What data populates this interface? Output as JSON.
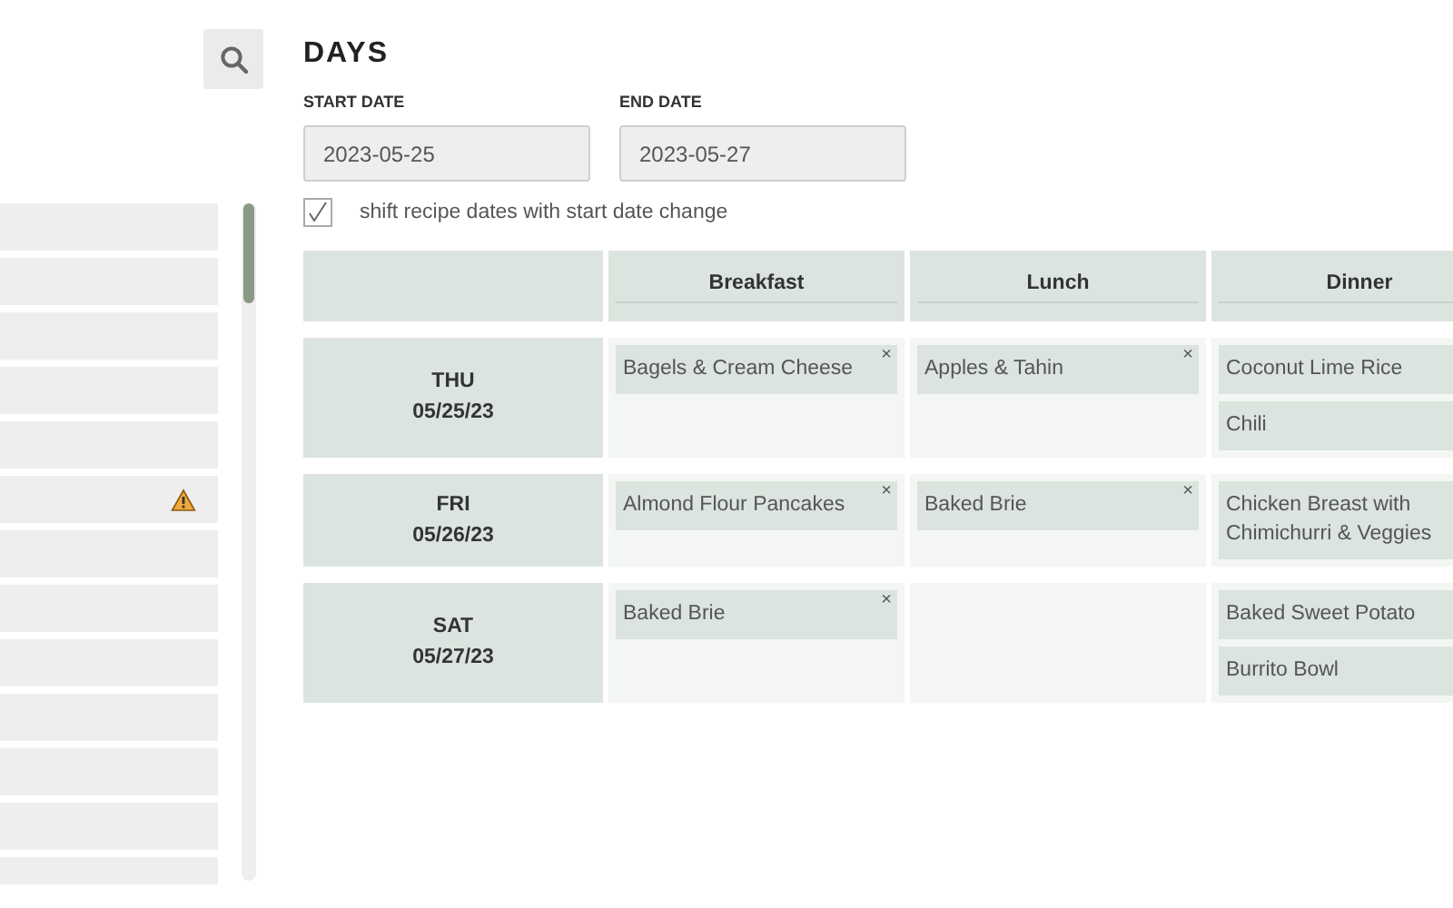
{
  "sidebar": {
    "rows": [
      {
        "warning": false
      },
      {
        "warning": false
      },
      {
        "warning": false
      },
      {
        "warning": false
      },
      {
        "warning": false
      },
      {
        "warning": true
      },
      {
        "warning": false
      },
      {
        "warning": false
      },
      {
        "warning": false
      },
      {
        "warning": false
      },
      {
        "warning": false
      },
      {
        "warning": false
      },
      {
        "warning": false
      }
    ]
  },
  "days": {
    "title": "DAYS",
    "start_date": {
      "label": "START DATE",
      "value": "2023-05-25"
    },
    "end_date": {
      "label": "END DATE",
      "value": "2023-05-27"
    },
    "shift_option": {
      "label": "shift recipe dates with start date change",
      "checked": true
    },
    "columns": [
      "Breakfast",
      "Lunch",
      "Dinner"
    ],
    "rows": [
      {
        "weekday": "THU",
        "date": "05/25/23",
        "meals": {
          "breakfast": [
            {
              "name": "Bagels & Cream Cheese",
              "remove": "×"
            }
          ],
          "lunch": [
            {
              "name": "Apples & Tahin",
              "remove": "×"
            }
          ],
          "dinner": [
            {
              "name": "Coconut Lime Rice"
            },
            {
              "name": "Chili"
            }
          ]
        }
      },
      {
        "weekday": "FRI",
        "date": "05/26/23",
        "meals": {
          "breakfast": [
            {
              "name": "Almond Flour Pancakes",
              "remove": "×"
            }
          ],
          "lunch": [
            {
              "name": "Baked Brie",
              "remove": "×"
            }
          ],
          "dinner": [
            {
              "name": "Chicken Breast with Chimichurri & Veggies"
            }
          ]
        }
      },
      {
        "weekday": "SAT",
        "date": "05/27/23",
        "meals": {
          "breakfast": [
            {
              "name": "Baked Brie",
              "remove": "×"
            }
          ],
          "dinner": [
            {
              "name": "Baked Sweet Potato"
            },
            {
              "name": "Burrito Bowl"
            }
          ]
        }
      }
    ]
  }
}
